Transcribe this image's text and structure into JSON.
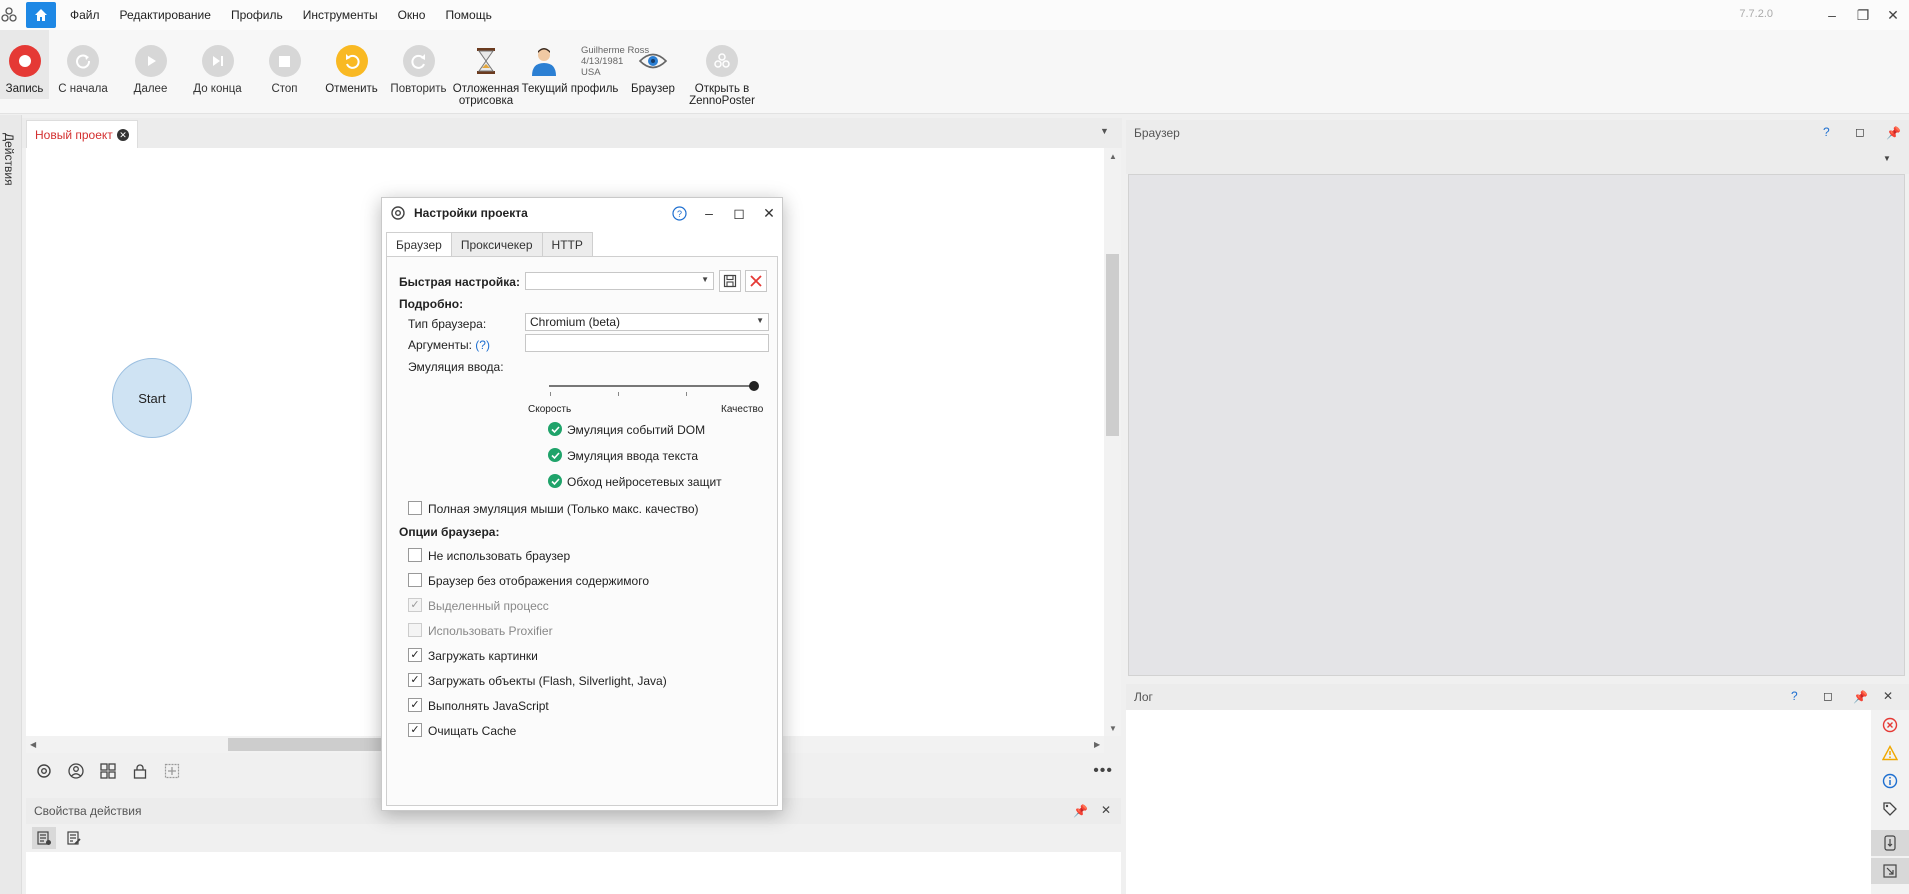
{
  "app": {
    "version": "7.7.2.0"
  },
  "menu": [
    "Файл",
    "Редактирование",
    "Профиль",
    "Инструменты",
    "Окно",
    "Помощь"
  ],
  "toolbar": {
    "record": "Запись",
    "from_start": "С начала",
    "next": "Далее",
    "to_end": "До конца",
    "stop": "Стоп",
    "undo": "Отменить",
    "redo": "Повторить",
    "deferred_line1": "Отложенная",
    "deferred_line2": "отрисовка",
    "current_profile": "Текущий профиль",
    "browser": "Браузер",
    "open_zp_line1": "Открыть в",
    "open_zp_line2": "ZennoPoster"
  },
  "profile": {
    "name": "Guilherme Ross",
    "dob": "4/13/1981",
    "country": "USA"
  },
  "sidebar": {
    "actions_tab": "Действия"
  },
  "document": {
    "tab": "Новый проект",
    "start_node": "Start"
  },
  "panels": {
    "action_properties": "Свойства действия",
    "browser": "Браузер",
    "log": "Лог"
  },
  "dialog": {
    "title": "Настройки проекта",
    "tabs": [
      "Браузер",
      "Проксичекер",
      "HTTP"
    ],
    "quick_setup": "Быстрая настройка:",
    "quick_setup_value": "",
    "details": "Подробно:",
    "browser_type_label": "Тип браузера:",
    "browser_type_value": "Chromium (beta)",
    "arguments_label": "Аргументы:",
    "arguments_help": "(?)",
    "arguments_value": "",
    "input_emulation_label": "Эмуляция ввода:",
    "slider_min": "Скорость",
    "slider_max": "Качество",
    "slider_value": 1.0,
    "emulation_features": [
      "Эмуляция событий DOM",
      "Эмуляция ввода текста",
      "Обход нейросетевых защит"
    ],
    "full_mouse": "Полная эмуляция мыши (Только макс. качество)",
    "browser_options": "Опции браузера:",
    "options": [
      {
        "label": "Не использовать браузер",
        "checked": false,
        "disabled": false
      },
      {
        "label": "Браузер без отображения содержимого",
        "checked": false,
        "disabled": false
      },
      {
        "label": "Выделенный процесс",
        "checked": true,
        "disabled": true
      },
      {
        "label": "Использовать Proxifier",
        "checked": false,
        "disabled": true
      },
      {
        "label": "Загружать картинки",
        "checked": true,
        "disabled": false
      },
      {
        "label": "Загружать объекты (Flash, Silverlight, Java)",
        "checked": true,
        "disabled": false
      },
      {
        "label": "Выполнять JavaScript",
        "checked": true,
        "disabled": false
      },
      {
        "label": "Очищать Cache",
        "checked": true,
        "disabled": false
      }
    ]
  },
  "colors": {
    "accent": "#1e88e5",
    "record": "#e53935",
    "undo": "#f9b923",
    "check": "#1fa36a",
    "tab_active": "#d32f2f"
  }
}
